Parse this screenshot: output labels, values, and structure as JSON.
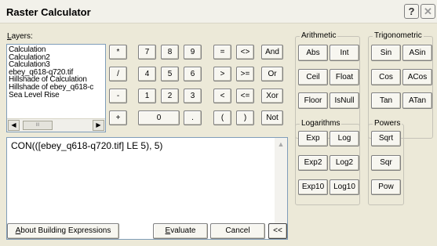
{
  "window": {
    "title": "Raster Calculator",
    "help_glyph": "?",
    "close_glyph": "✕"
  },
  "layers": {
    "label": "Layers:",
    "label_mnemonic": "L",
    "label_rest": "ayers:",
    "items": [
      "Calculation",
      "Calculation2",
      "Calculation3",
      "ebey_q618-q720.tif",
      "Hillshade of Calculation",
      "Hillshade of ebey_q618-c",
      "Sea Level Rise"
    ],
    "scroll_left": "◀",
    "scroll_right": "▶",
    "thumb_grip": "III"
  },
  "keypad": {
    "row1": [
      "*",
      "7",
      "8",
      "9",
      "=",
      "<>",
      "And"
    ],
    "row2": [
      "/",
      "4",
      "5",
      "6",
      ">",
      ">=",
      "Or"
    ],
    "row3": [
      "-",
      "1",
      "2",
      "3",
      "<",
      "<=",
      "Xor"
    ],
    "row4": [
      "+",
      "0",
      ".",
      "(",
      ")",
      "Not"
    ]
  },
  "expression": {
    "text": "CON(([ebey_q618-q720.tif] LE 5), 5)",
    "scroll_up": "▲",
    "scroll_down": "▼"
  },
  "groups": {
    "arithmetic": {
      "label": "Arithmetic",
      "buttons": [
        "Abs",
        "Int",
        "Ceil",
        "Float",
        "Floor",
        "IsNull"
      ]
    },
    "trigonometric": {
      "label": "Trigonometric",
      "buttons": [
        "Sin",
        "ASin",
        "Cos",
        "ACos",
        "Tan",
        "ATan"
      ]
    },
    "logarithms": {
      "label": "Logarithms",
      "buttons": [
        "Exp",
        "Log",
        "Exp2",
        "Log2",
        "Exp10",
        "Log10"
      ]
    },
    "powers": {
      "label": "Powers",
      "buttons": [
        "Sqrt",
        "Sqr",
        "Pow"
      ]
    }
  },
  "footer": {
    "about": "About Building Expressions",
    "about_mnemonic": "A",
    "about_rest": "bout Building Expressions",
    "evaluate": "Evaluate",
    "evaluate_mnemonic": "E",
    "evaluate_rest": "valuate",
    "cancel": "Cancel",
    "collapse": "<<"
  }
}
